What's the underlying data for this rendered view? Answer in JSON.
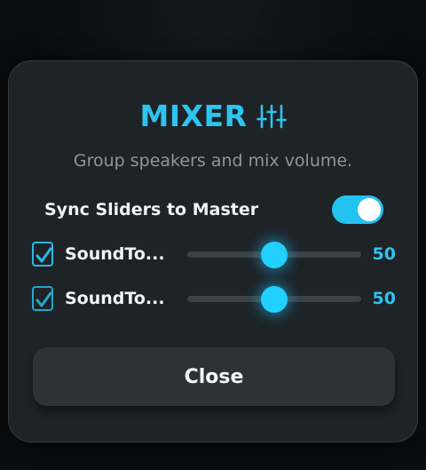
{
  "dialog": {
    "title": "MIXER",
    "title_icon": "sliders-icon",
    "subtitle": "Group speakers and mix volume.",
    "sync": {
      "label": "Sync Sliders to Master",
      "enabled": true
    },
    "speakers": [
      {
        "name": "SoundTo...",
        "checked": true,
        "volume": 50,
        "volume_label": "50"
      },
      {
        "name": "SoundTo...",
        "checked": true,
        "volume": 50,
        "volume_label": "50"
      }
    ],
    "close_label": "Close"
  },
  "colors": {
    "accent": "#2ec4f0",
    "panel": "#1d2327",
    "button": "#2c3337",
    "text": "#f1f3f4",
    "muted": "#8d969c"
  }
}
